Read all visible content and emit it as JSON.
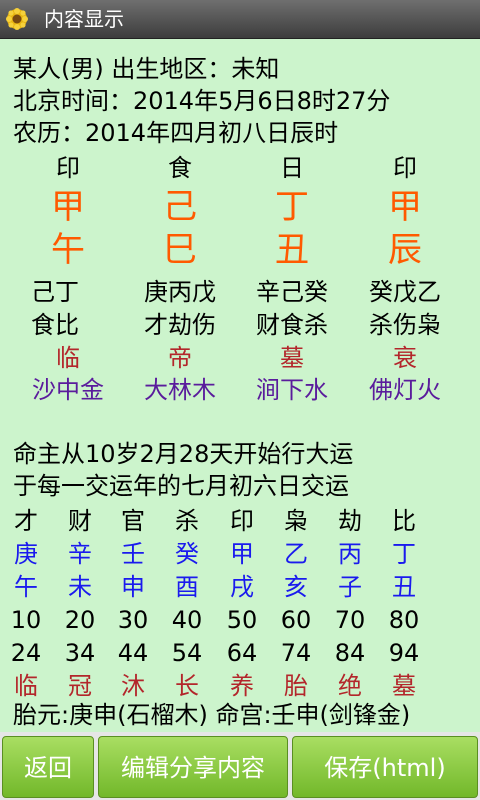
{
  "title_bar": {
    "title": "内容显示",
    "icon": "sunflower-icon"
  },
  "info": {
    "line1": "某人(男) 出生地区：未知",
    "line2": "北京时间：2014年5月6日8时27分",
    "line3": "农历：2014年四月初八日辰时"
  },
  "pillars": [
    {
      "god": "印",
      "stem": "甲",
      "branch": "午",
      "hidden": "己丁",
      "hidden_gods": "食比",
      "phase": "临",
      "nayin": "沙中金"
    },
    {
      "god": "食",
      "stem": "己",
      "branch": "巳",
      "hidden": "庚丙戊",
      "hidden_gods": "才劫伤",
      "phase": "帝",
      "nayin": "大林木"
    },
    {
      "god": "日",
      "stem": "丁",
      "branch": "丑",
      "hidden": "辛己癸",
      "hidden_gods": "财食杀",
      "phase": "墓",
      "nayin": "涧下水"
    },
    {
      "god": "印",
      "stem": "甲",
      "branch": "辰",
      "hidden": "癸戊乙",
      "hidden_gods": "杀伤枭",
      "phase": "衰",
      "nayin": "佛灯火"
    }
  ],
  "luck": {
    "intro1": "命主从10岁2月28天开始行大运",
    "intro2": "于每一交运年的七月初六日交运",
    "gods": [
      "才",
      "财",
      "官",
      "杀",
      "印",
      "枭",
      "劫",
      "比"
    ],
    "stems": [
      "庚",
      "辛",
      "壬",
      "癸",
      "甲",
      "乙",
      "丙",
      "丁"
    ],
    "branches": [
      "午",
      "未",
      "申",
      "酉",
      "戌",
      "亥",
      "子",
      "丑"
    ],
    "start_ages": [
      "10",
      "20",
      "30",
      "40",
      "50",
      "60",
      "70",
      "80"
    ],
    "end_ages": [
      "24",
      "34",
      "44",
      "54",
      "64",
      "74",
      "84",
      "94"
    ],
    "phases": [
      "临",
      "冠",
      "沐",
      "长",
      "养",
      "胎",
      "绝",
      "墓"
    ]
  },
  "footer_text": "胎元:庚申(石榴木) 命宫:壬申(剑锋金)",
  "buttons": {
    "back": "返回",
    "edit_share": "编辑分享内容",
    "save": "保存(html)"
  },
  "colors": {
    "content_bg": "#ccf4cc",
    "stem_branch": "#ff5a00",
    "phase": "#b3262b",
    "nayin": "#5a1c9c",
    "luck_stem_branch": "#1a1aee",
    "button_green": "#8ccb45"
  }
}
